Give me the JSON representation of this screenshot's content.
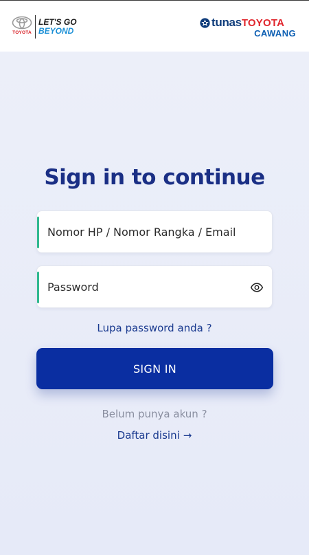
{
  "header": {
    "brand": {
      "wordmark": "TOYOTA",
      "tagline_line1": "LET'S GO",
      "tagline_line2": "BEYOND"
    },
    "dealer": {
      "name_part1": "tunas",
      "name_part2": "TOYOTA",
      "branch": "CAWANG"
    }
  },
  "form": {
    "title": "Sign in to continue",
    "identity_placeholder": "Nomor HP / Nomor Rangka / Email",
    "password_placeholder": "Password",
    "forgot_link": "Lupa password anda ?",
    "submit_label": "SIGN IN",
    "no_account_text": "Belum punya akun ?",
    "register_link": "Daftar disini",
    "register_arrow": "→"
  },
  "icons": {
    "eye": "eye-icon",
    "toyota_emblem": "toyota-emblem-icon",
    "dealer_emblem": "tunas-emblem-icon"
  },
  "colors": {
    "primary": "#0a2ea1",
    "title": "#1a2f85",
    "accent": "#2fb88f",
    "link": "#1a3a8f",
    "toyota_red": "#d71920",
    "tagline_blue": "#1a8fd6"
  }
}
